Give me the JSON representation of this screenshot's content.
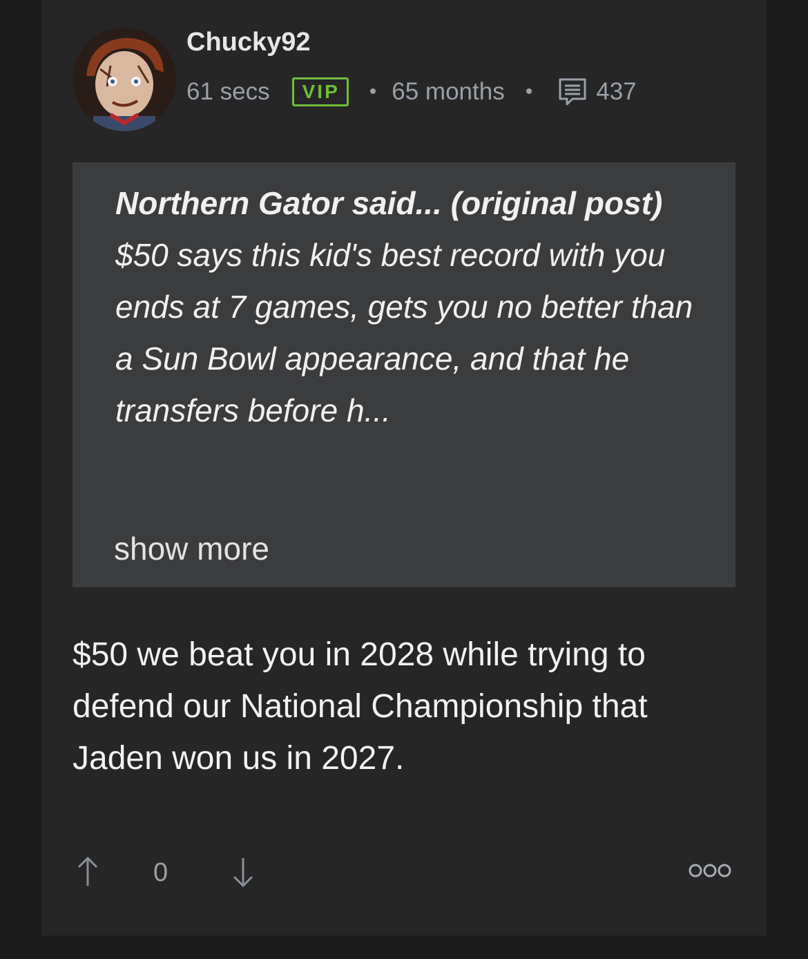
{
  "post": {
    "username": "Chucky92",
    "time_ago": "61 secs",
    "badge": "VIP",
    "separator": "•",
    "membership": "65 months",
    "post_count": "437",
    "quote": {
      "author_intro": "Northern Gator said... (original post)",
      "text": " $50 says this kid's best record with you ends at 7 games, gets you no better than a Sun Bowl appearance, and that he transfers before h...",
      "show_more_label": "show more"
    },
    "body": "$50 we beat you in 2028 while trying to defend our National Championship that Jaden won us in 2027.",
    "vote_count": "0",
    "icons": {
      "upvote": "arrow-up-icon",
      "downvote": "arrow-down-icon",
      "comments": "message-icon",
      "more": "more-options-icon"
    }
  },
  "colors": {
    "page_bg": "#1b1b1c",
    "card_bg": "#262627",
    "quote_bg": "#3b3c3e",
    "vip_green": "#6fbe3a",
    "meta_gray": "#9aa1a8"
  }
}
